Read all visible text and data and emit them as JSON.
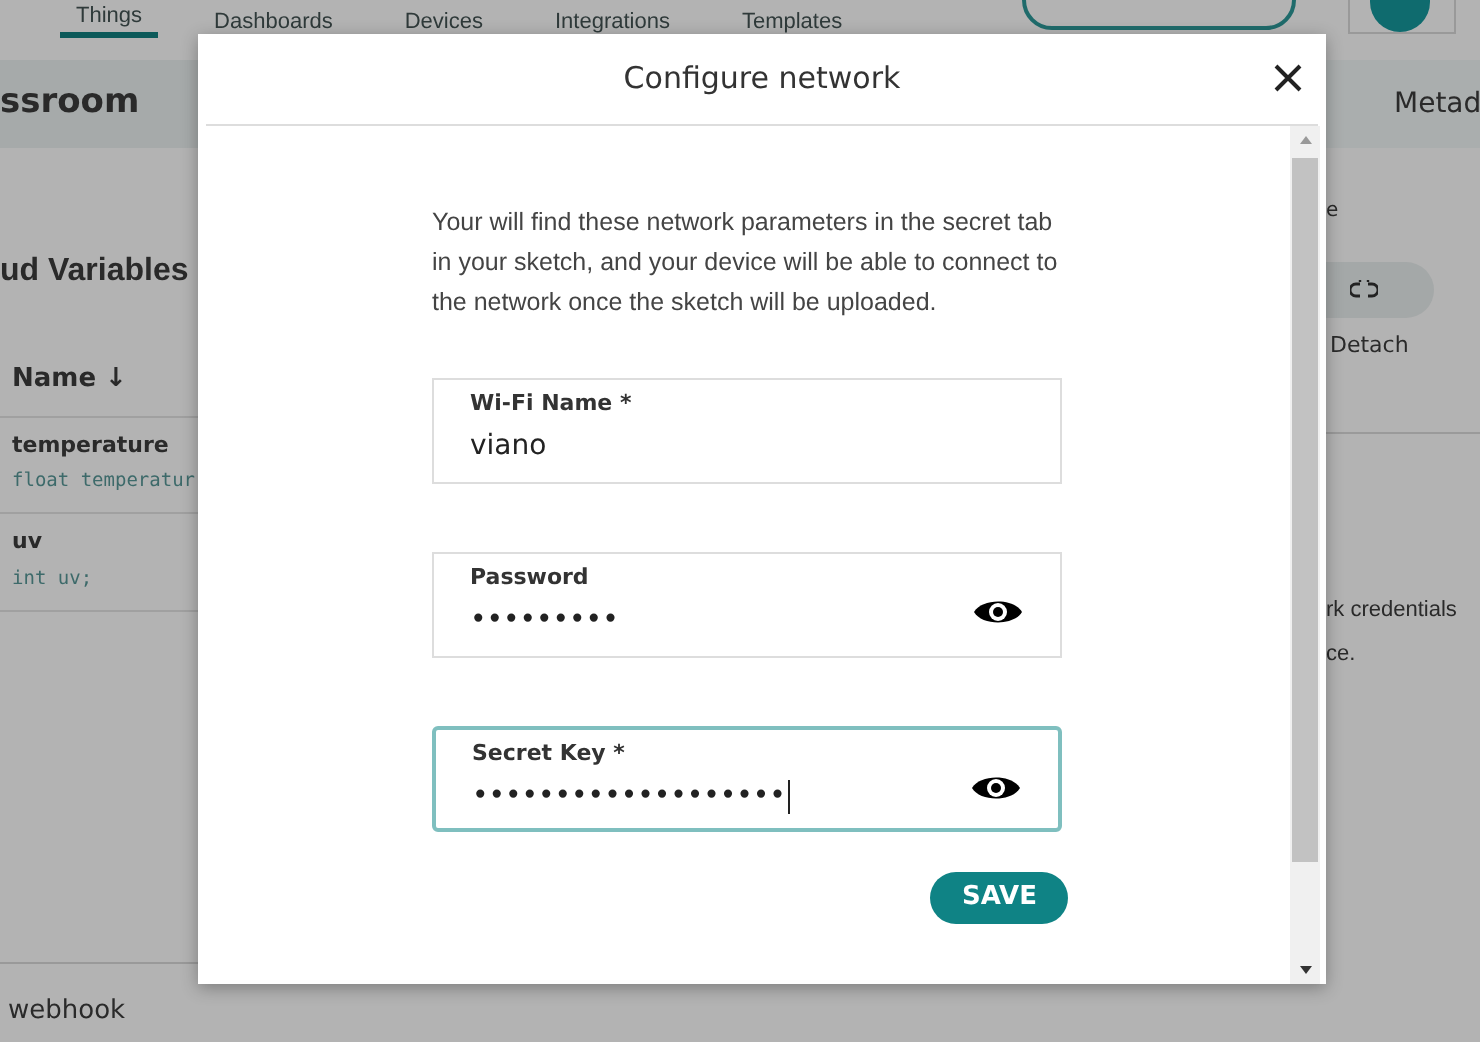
{
  "nav": {
    "tabs": [
      {
        "label": "Things",
        "selected": true
      },
      {
        "label": "Dashboards",
        "selected": false
      },
      {
        "label": "Devices",
        "selected": false
      },
      {
        "label": "Integrations",
        "selected": false
      },
      {
        "label": "Templates",
        "selected": false
      }
    ]
  },
  "thing": {
    "title": "ssroom",
    "variables_heading": "ud Variables",
    "column": "Name",
    "sort_icon": "↓",
    "rows": [
      {
        "name": "temperature",
        "declaration": "float temperatur"
      },
      {
        "name": "uv",
        "declaration": "int uv;"
      }
    ]
  },
  "side": {
    "tab": "Metad",
    "label": "e",
    "detach": "Detach",
    "lines": [
      "rk credentials",
      "ce."
    ]
  },
  "footer": {
    "text": "webhook"
  },
  "modal": {
    "title": "Configure network",
    "intro": "Your will find these network parameters in the secret tab in your sketch, and your device will be able to connect to the network once the sketch will be uploaded.",
    "fields": [
      {
        "label": "Wi-Fi Name *",
        "value": "viano",
        "kind": "text",
        "focused": false
      },
      {
        "label": "Password",
        "value": "•••••••••",
        "kind": "secret",
        "focused": false
      },
      {
        "label": "Secret Key *",
        "value": "•••••••••••••••••••",
        "kind": "secret",
        "focused": true
      }
    ],
    "save": "SAVE"
  }
}
